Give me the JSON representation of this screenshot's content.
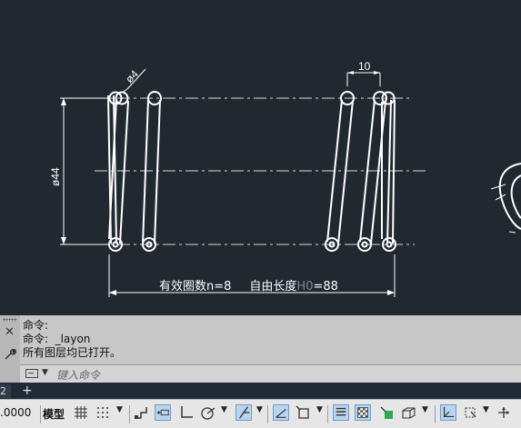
{
  "drawing": {
    "dim_wire": "ø4",
    "dim_pitch": "10",
    "dim_diameter": "ø44",
    "note_label": "有效圈数n=8",
    "note_free_prefix": "自由长度",
    "note_free_var": "H0",
    "note_free_value": "=88"
  },
  "command": {
    "history": [
      "命令:",
      "命令:  _layon",
      "所有图层均已打开。"
    ],
    "placeholder": "键入命令"
  },
  "tabs": {
    "partial_label": "2",
    "add": "+"
  },
  "status": {
    "coord": ".0000",
    "model": "模型"
  },
  "colors": {
    "canvas": "#212830",
    "lines": "#ffffff",
    "hidden_text": "#7c8792"
  }
}
